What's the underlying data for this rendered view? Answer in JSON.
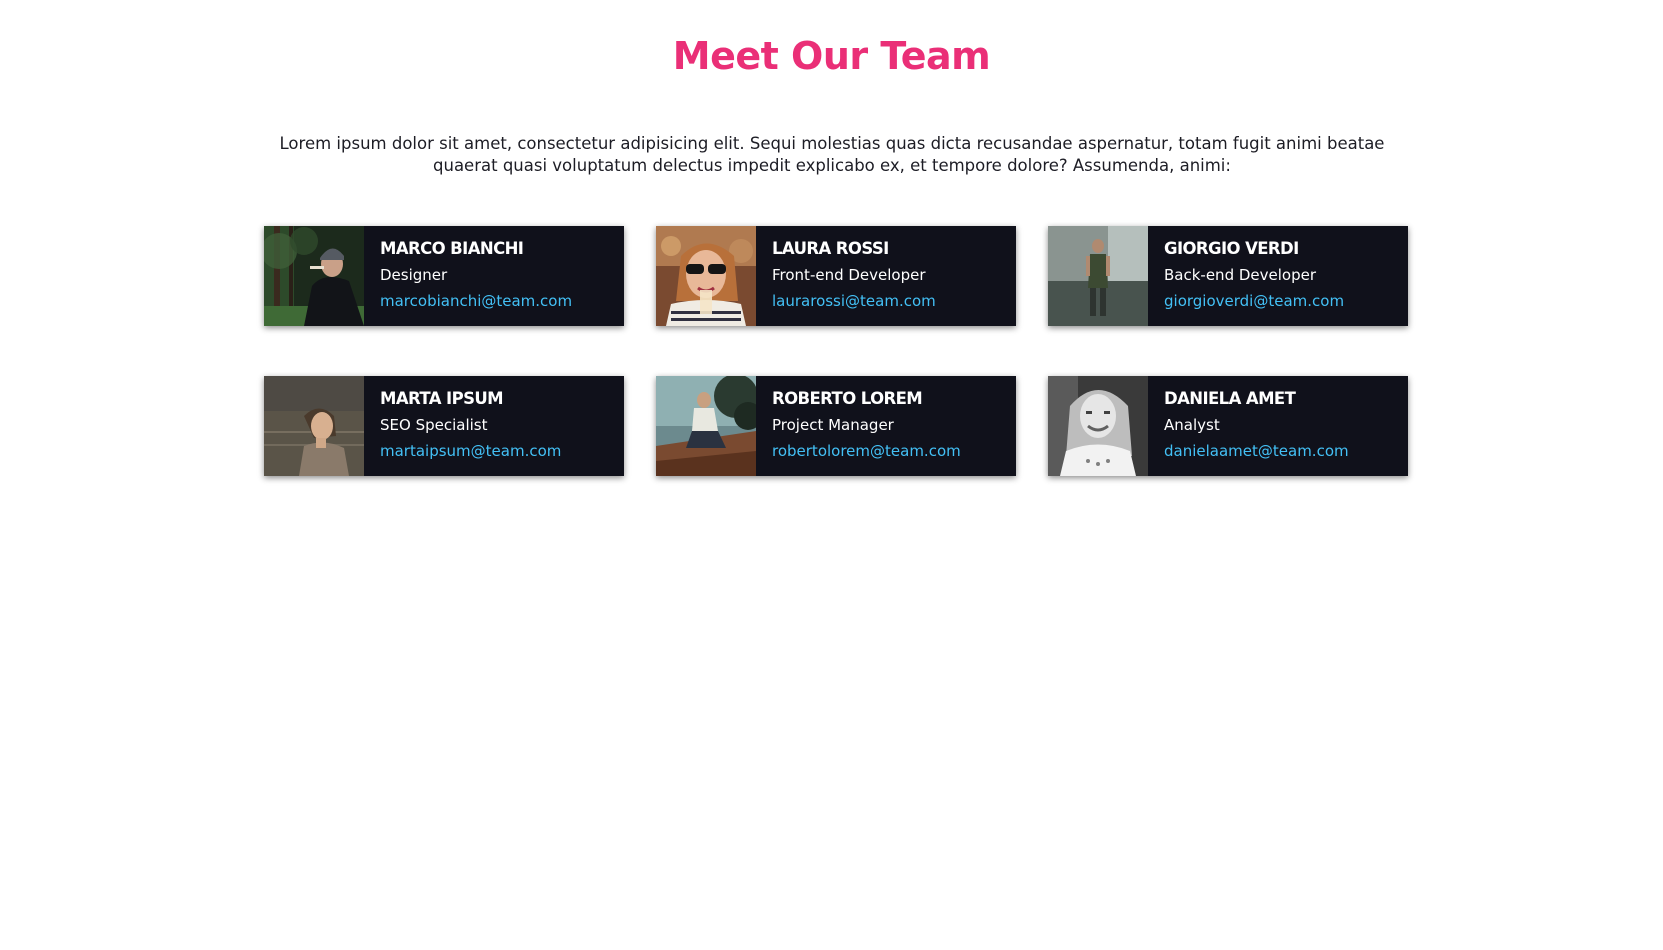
{
  "page": {
    "title": "Meet Our Team",
    "intro": "Lorem ipsum dolor sit amet, consectetur adipisicing elit. Sequi molestias quas dicta recusandae aspernatur, totam fugit animi beatae quaerat quasi voluptatum delectus impedit explicabo ex, et tempore dolore? Assumenda, animi:"
  },
  "colors": {
    "title": "#ea2f77",
    "card_bg": "#10111b",
    "email": "#43c0f5"
  },
  "members": [
    {
      "name": "MARCO BIANCHI",
      "role": "Designer",
      "email": "marcobianchi@team.com"
    },
    {
      "name": "LAURA ROSSI",
      "role": "Front-end Developer",
      "email": "laurarossi@team.com"
    },
    {
      "name": "GIORGIO VERDI",
      "role": "Back-end Developer",
      "email": "giorgioverdi@team.com"
    },
    {
      "name": "MARTA IPSUM",
      "role": "SEO Specialist",
      "email": "martaipsum@team.com"
    },
    {
      "name": "ROBERTO LOREM",
      "role": "Project Manager",
      "email": "robertolorem@team.com"
    },
    {
      "name": "DANIELA AMET",
      "role": "Analyst",
      "email": "danielaamet@team.com"
    }
  ]
}
